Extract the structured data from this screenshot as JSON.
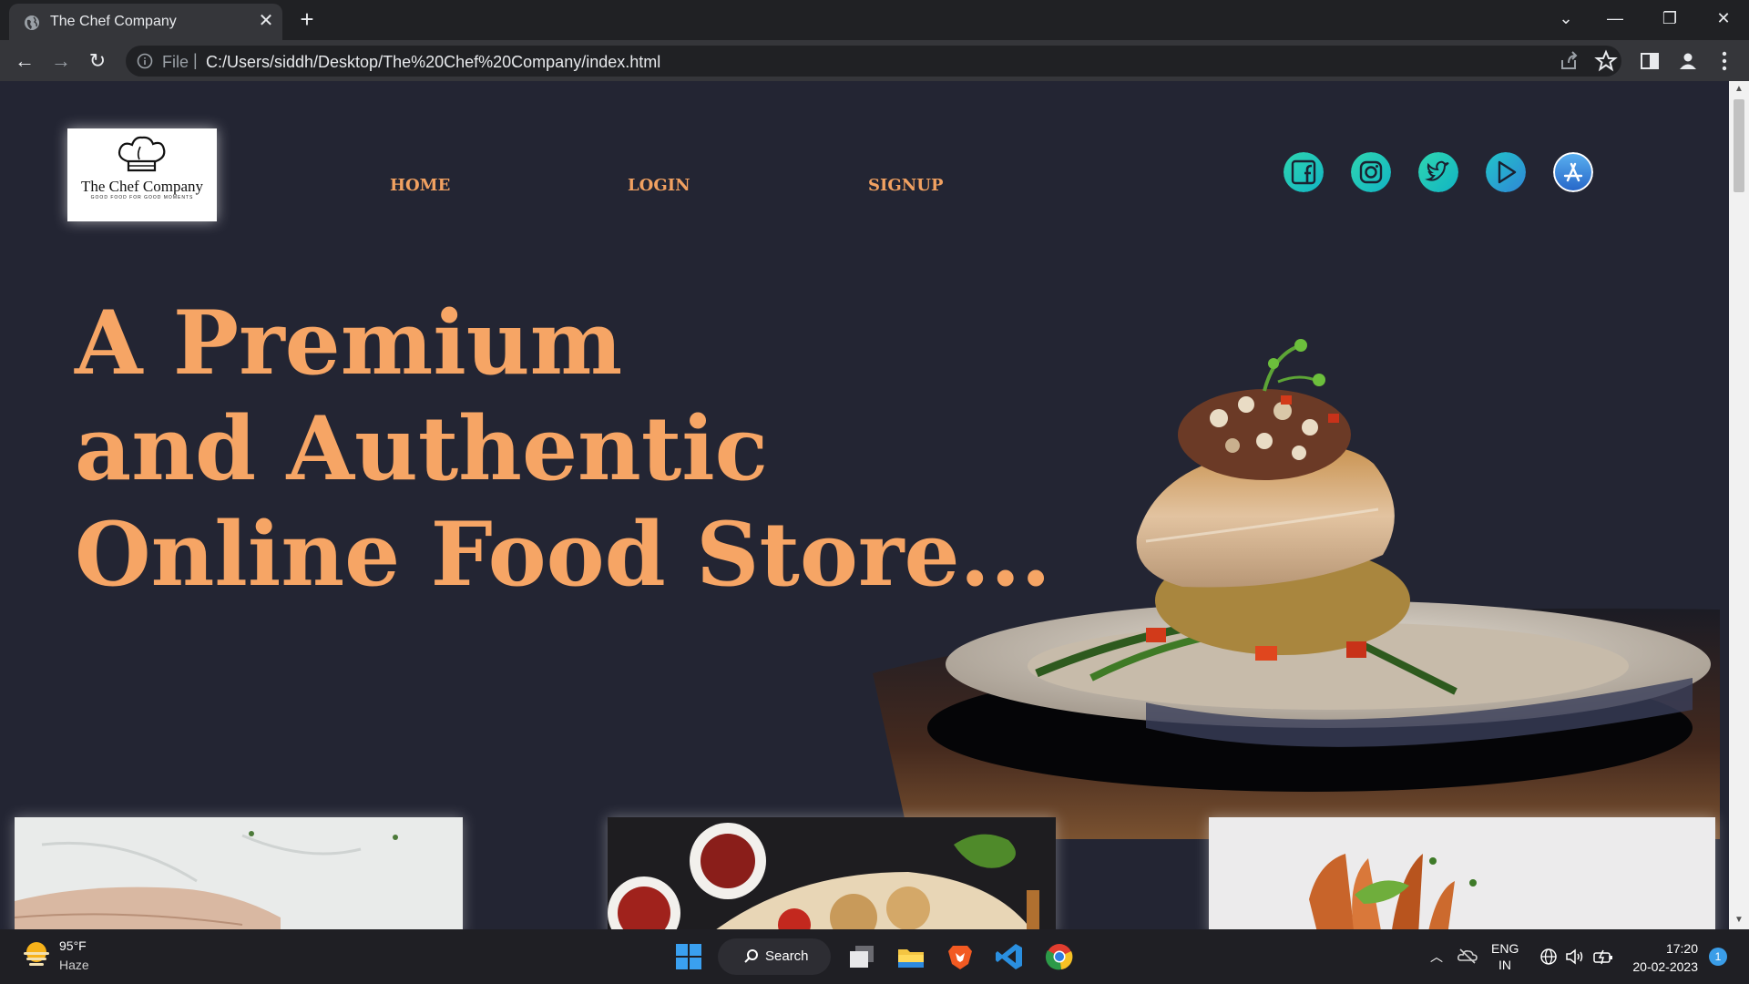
{
  "browser": {
    "tab_title": "The Chef Company",
    "tab_close": "✕",
    "new_tab": "+",
    "window_controls": {
      "tab_search": "⌄",
      "minimize": "—",
      "restore": "❐",
      "close": "✕"
    },
    "address": {
      "scheme_label": "File",
      "separator": "|",
      "url": "C:/Users/siddh/Desktop/The%20Chef%20Company/index.html"
    },
    "nav": {
      "back": "←",
      "forward": "→",
      "reload": "↻"
    }
  },
  "page": {
    "logo": {
      "name": "The Chef Company",
      "tagline": "GOOD FOOD FOR GOOD MOMENTS"
    },
    "nav_links": [
      {
        "label": "HOME"
      },
      {
        "label": "LOGIN"
      },
      {
        "label": "SIGNUP"
      }
    ],
    "social_icons": [
      "facebook-icon",
      "instagram-icon",
      "twitter-icon",
      "play-store-icon",
      "app-store-icon"
    ],
    "hero_lines": [
      "A Premium",
      "and Authentic",
      "Online Food Store..."
    ],
    "colors": {
      "accent": "#f6a565",
      "page_bg": "#232533",
      "social_teal": "#1ec8b8",
      "social_blue": "#3c8fd8"
    }
  },
  "taskbar": {
    "weather": {
      "temp": "95°F",
      "condition": "Haze"
    },
    "search_label": "Search",
    "language": {
      "line1": "ENG",
      "line2": "IN"
    },
    "time": "17:20",
    "date": "20-02-2023",
    "notification_count": "1"
  }
}
